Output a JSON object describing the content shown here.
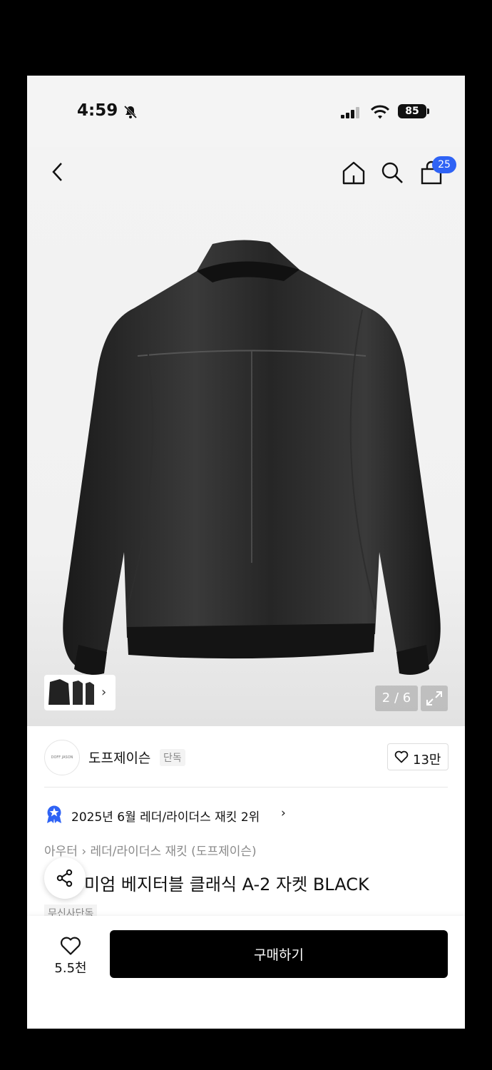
{
  "status_bar": {
    "time": "4:59",
    "battery": "85"
  },
  "nav": {
    "cart_count": "25"
  },
  "gallery": {
    "counter": "2 / 6"
  },
  "brand": {
    "name": "도프제이슨",
    "tag": "단독",
    "logo_text": "DOFF JASON",
    "likes": "13만"
  },
  "ranking": {
    "text": "2025년 6월 레더/라이더스 재킷 2위",
    "arrow": "›"
  },
  "breadcrumb": {
    "text": "아우터  ›  레더/라이더스 재킷 (도프제이슨)"
  },
  "product": {
    "title": "미엄 베지터블 클래식 A-2 자켓 BLACK",
    "tag": "무신사단독"
  },
  "bottom": {
    "wish_count": "5.5천",
    "buy_label": "구매하기"
  },
  "colors": {
    "accent": "#2f63f5",
    "buy_bg": "#000000"
  }
}
